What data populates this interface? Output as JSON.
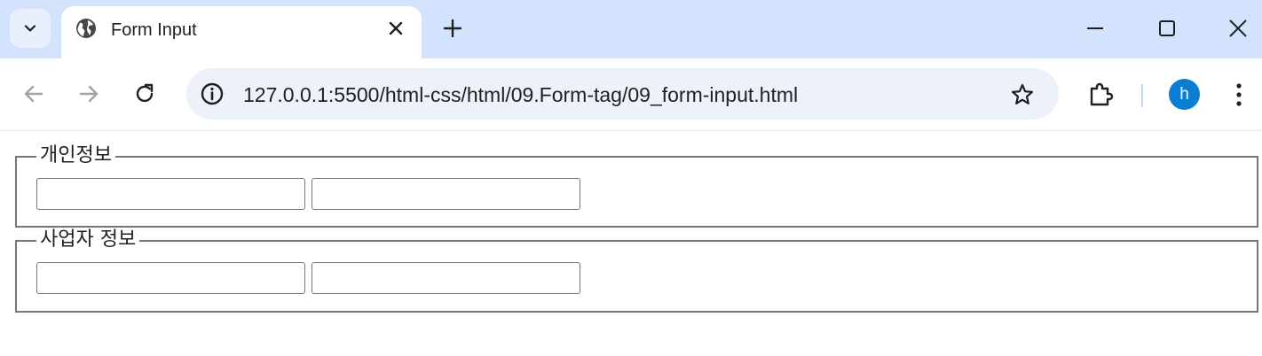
{
  "browser": {
    "tab": {
      "title": "Form Input",
      "favicon": "globe-icon"
    },
    "address_bar": {
      "url": "127.0.0.1:5500/html-css/html/09.Form-tag/09_form-input.html"
    },
    "profile": {
      "initial": "h",
      "color": "#0b7dd4"
    },
    "colors": {
      "tabbar_bg": "#d3e3fd",
      "omnibox_bg": "#edf2fa"
    }
  },
  "form": {
    "fieldsets": [
      {
        "legend": "개인정보",
        "inputs": [
          {
            "value": "",
            "placeholder": ""
          },
          {
            "value": "",
            "placeholder": ""
          }
        ]
      },
      {
        "legend": "사업자 정보",
        "inputs": [
          {
            "value": "",
            "placeholder": ""
          },
          {
            "value": "",
            "placeholder": ""
          }
        ]
      }
    ]
  }
}
